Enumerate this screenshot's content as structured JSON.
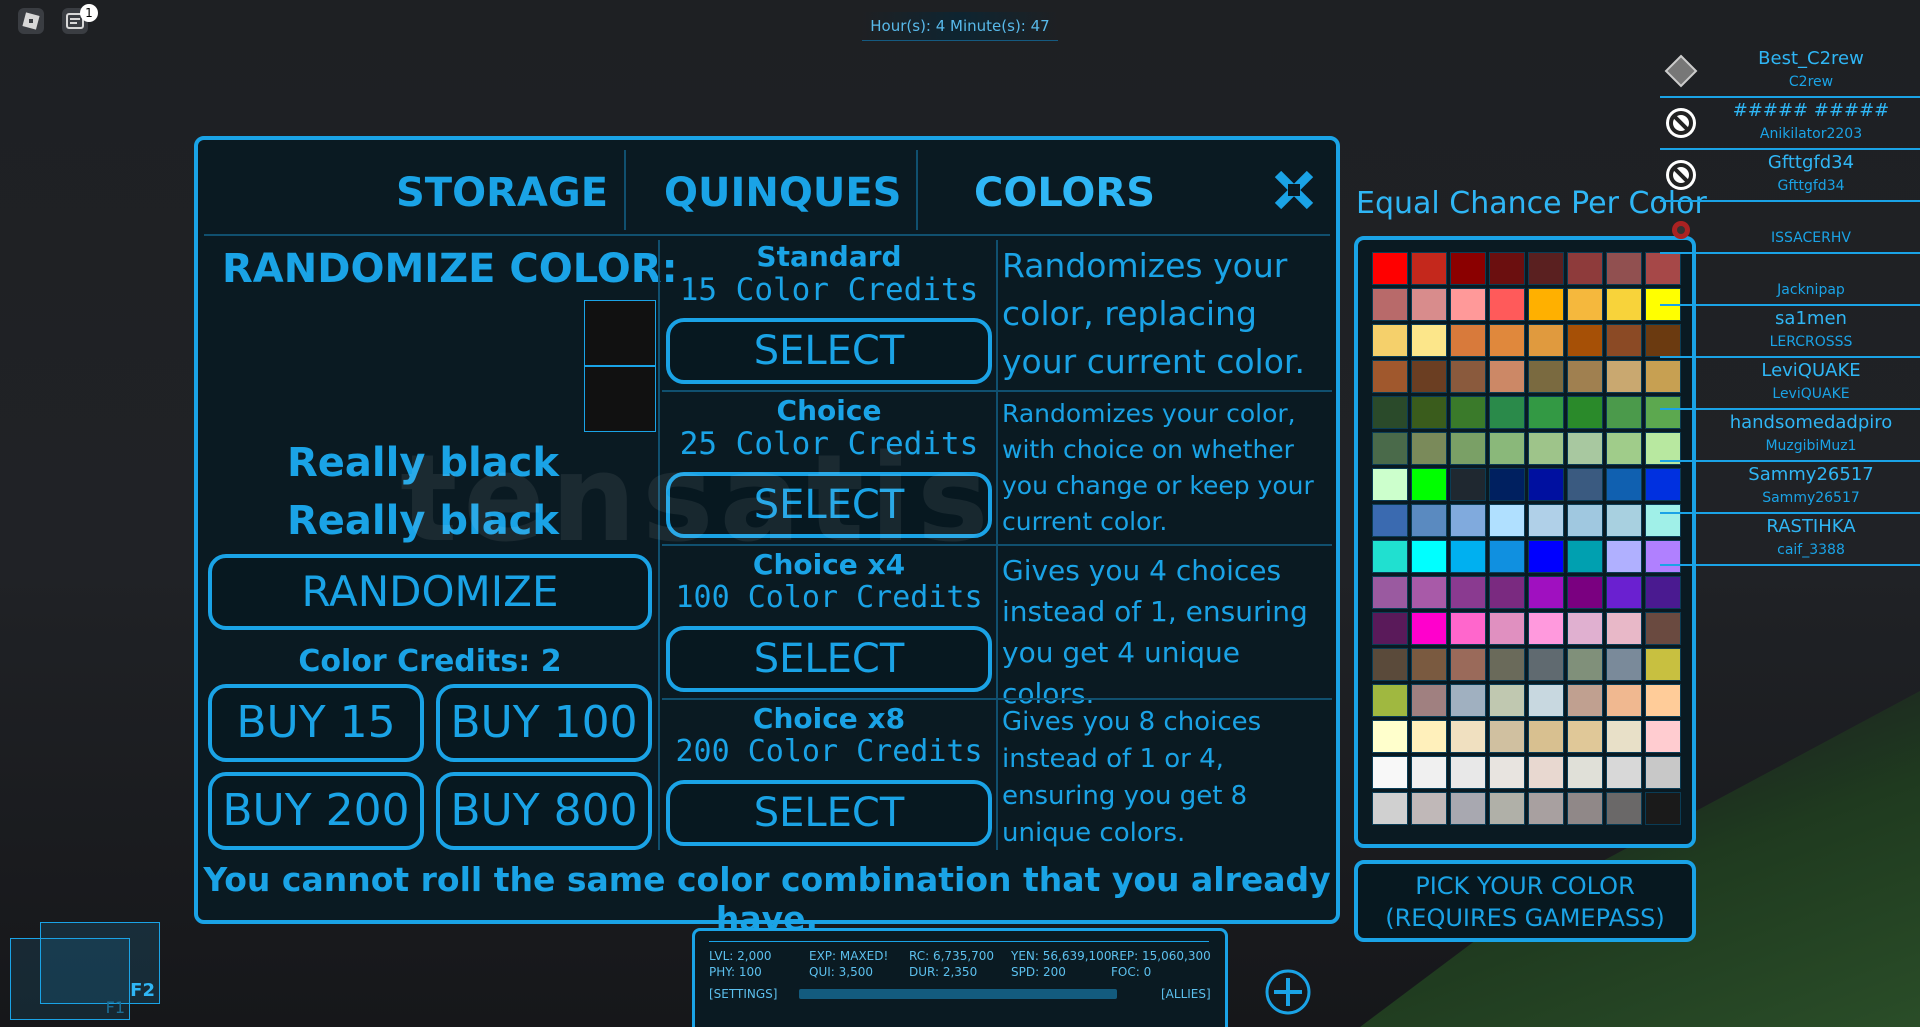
{
  "hud": {
    "notif_count": "1",
    "timer": "Hour(s): 4 Minute(s): 47"
  },
  "tabs": [
    "STORAGE",
    "QUINQUES",
    "COLORS"
  ],
  "randomize": {
    "title": "RANDOMIZE COLOR:",
    "color_primary": "Really black",
    "color_secondary": "Really black",
    "button": "RANDOMIZE",
    "credits": "Color Credits: 2",
    "buy": [
      "BUY 15",
      "BUY 100",
      "BUY 200",
      "BUY 800"
    ]
  },
  "options": [
    {
      "name": "Standard",
      "cost": "15 Color Credits",
      "button": "SELECT",
      "desc": "Randomizes your color, replacing your current color."
    },
    {
      "name": "Choice",
      "cost": "25 Color Credits",
      "button": "SELECT",
      "desc": "Randomizes your color, with choice on whether you  change or keep your current color."
    },
    {
      "name": "Choice x4",
      "cost": "100 Color Credits",
      "button": "SELECT",
      "desc": "Gives you 4 choices instead of 1, ensuring you get 4 unique colors."
    },
    {
      "name": "Choice x8",
      "cost": "200 Color Credits",
      "button": "SELECT",
      "desc": "Gives you 8 choices instead of 1 or 4, ensuring you get 8 unique colors."
    }
  ],
  "footer_note": "You cannot roll the same color combination that you already have.",
  "palette": {
    "title": "Equal Chance Per Color",
    "pick_button_line1": "PICK YOUR COLOR",
    "pick_button_line2": "(REQUIRES GAMEPASS)",
    "colors": [
      "#ff0000",
      "#c4281c",
      "#8b0000",
      "#6b0f0f",
      "#5a2020",
      "#8e3b3b",
      "#915050",
      "#a64848",
      "#b86a6a",
      "#d88c8c",
      "#ff9999",
      "#ff5a5a",
      "#ffb000",
      "#f5b83d",
      "#f8d33a",
      "#ffff00",
      "#f5d06b",
      "#fce68a",
      "#d87a3b",
      "#e0883c",
      "#e09a3e",
      "#a65006",
      "#8b4a25",
      "#6b3a10",
      "#a0582d",
      "#6b3e22",
      "#8a5a3d",
      "#cc8866",
      "#7a6a40",
      "#a08050",
      "#c9a870",
      "#c7a052",
      "#2a4a2a",
      "#3a5c1c",
      "#3a7a2a",
      "#2a8a4a",
      "#339944",
      "#2a8a2a",
      "#4b9a4b",
      "#5ca84f",
      "#4a6a4a",
      "#7a8a5a",
      "#7aa066",
      "#8ab87a",
      "#9ec48a",
      "#a8c8a0",
      "#a0cc8a",
      "#b8e8a0",
      "#ccffcc",
      "#00ff00",
      "#1f2830",
      "#002060",
      "#0010a0",
      "#3a5a80",
      "#1060b0",
      "#0030e0",
      "#3a6ab0",
      "#5a8ac0",
      "#80aadd",
      "#b0e0ff",
      "#b0d0e8",
      "#a0c8e0",
      "#a8d0e0",
      "#a0f0e8",
      "#20e0d0",
      "#00ffff",
      "#00b0f0",
      "#1090e0",
      "#0000ff",
      "#00a0b0",
      "#b0b0ff",
      "#b080ff",
      "#9a5aa0",
      "#a85aa8",
      "#8a3a90",
      "#7a2a80",
      "#a010c0",
      "#7a0080",
      "#6a20d0",
      "#4a1a90",
      "#5a1a5a",
      "#ff00cc",
      "#ff66cc",
      "#e090c0",
      "#ff99dd",
      "#e0b0d0",
      "#e8b8c8",
      "#6a4a40",
      "#5a4a3a",
      "#7a5a40",
      "#9a6a5a",
      "#6a6a5a",
      "#606a70",
      "#80907a",
      "#7a8a9a",
      "#c8c040",
      "#a0b840",
      "#a08080",
      "#a0b0c0",
      "#c0c8b0",
      "#c8d8e0",
      "#c0a090",
      "#f0b890",
      "#ffcc99",
      "#ffffcc",
      "#fff0bb",
      "#f0e0c0",
      "#d0c0a0",
      "#d8c090",
      "#e0c898",
      "#e8e0c8",
      "#ffccd0",
      "#f8f8f8",
      "#f0f0f0",
      "#e8e8e8",
      "#e8e4e0",
      "#e8d8d0",
      "#e0e0d8",
      "#d8d8d8",
      "#c8c8c8",
      "#d0d0d0",
      "#c0b8b8",
      "#a8a8b0",
      "#b0b0a8",
      "#a8a0a0",
      "#908888",
      "#6a6868",
      "#1a1a1a"
    ]
  },
  "players": [
    {
      "display": "Best_C2rew",
      "user": "C2rew",
      "avatar": "diamond-avatar"
    },
    {
      "display": "##### #####",
      "user": "Anikilator2203",
      "avatar": "blocked-icon"
    },
    {
      "display": "Gfttgfd34",
      "user": "Gfttgfd34",
      "avatar": "blocked-icon"
    },
    {
      "display": "",
      "user": "ISSACERHV",
      "avatar": "red-avatar"
    },
    {
      "display": "",
      "user": "Jacknipap",
      "avatar": ""
    },
    {
      "display": "sa1men",
      "user": "LERCROSSS",
      "avatar": ""
    },
    {
      "display": "LeviQUAKE",
      "user": "LeviQUAKE",
      "avatar": ""
    },
    {
      "display": "handsomedadpiro",
      "user": "MuzgibiMuz1",
      "avatar": ""
    },
    {
      "display": "Sammy26517",
      "user": "Sammy26517",
      "avatar": ""
    },
    {
      "display": "RASTIHKA",
      "user": "caif_3388",
      "avatar": ""
    }
  ],
  "stats": {
    "lvl": "LVL: 2,000",
    "phy": "PHY: 100",
    "exp": "EXP: MAXED!",
    "qui": "QUI: 3,500",
    "rc": "RC: 6,735,700",
    "dur": "DUR: 2,350",
    "yen": "YEN: 56,639,100",
    "spd": "SPD: 200",
    "rep": "REP: 15,060,300",
    "foc": "FOC: 0",
    "settings": "[SETTINGS]",
    "allies": "[ALLIES]"
  },
  "hotkeys": {
    "f2": "F2",
    "f1": "F1"
  },
  "accent": "#1aa3e6"
}
